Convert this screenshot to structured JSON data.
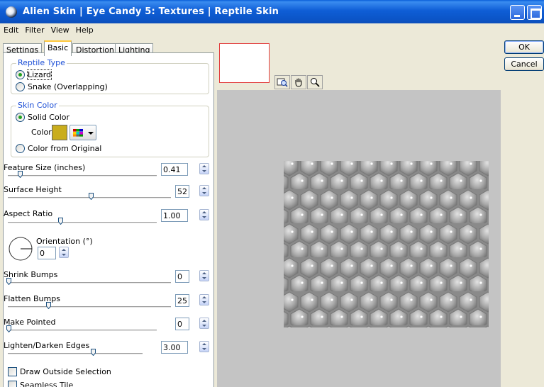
{
  "window": {
    "title": "Alien Skin | Eye Candy 5: Textures | Reptile Skin"
  },
  "menu": [
    "Edit",
    "Filter",
    "View",
    "Help"
  ],
  "tabs": [
    "Settings",
    "Basic",
    "Distortion",
    "Lighting"
  ],
  "active_tab": "Basic",
  "reptile_type": {
    "title": "Reptile Type",
    "options": [
      "Lizard",
      "Snake (Overlapping)"
    ],
    "selected": "Lizard"
  },
  "skin_color": {
    "title": "Skin Color",
    "solid_label": "Solid Color",
    "color_label": "Color",
    "from_original_label": "Color from Original",
    "selected": "Solid Color",
    "swatch_color": "#c9ad1c"
  },
  "controls": {
    "feature_size": {
      "label": "Feature Size (inches)",
      "value": "0.41",
      "level": 0.08
    },
    "surface_height": {
      "label": "Surface Height",
      "value": "52",
      "level": 0.52
    },
    "aspect_ratio": {
      "label": "Aspect Ratio",
      "value": "1.00",
      "level": 0.36
    },
    "orientation": {
      "label": "Orientation (°)",
      "value": "0"
    },
    "shrink_bumps": {
      "label": "Shrink Bumps",
      "value": "0",
      "level": 0.0
    },
    "flatten_bumps": {
      "label": "Flatten Bumps",
      "value": "25",
      "level": 0.25
    },
    "make_pointed": {
      "label": "Make Pointed",
      "value": "0",
      "level": 0.0
    },
    "lighten_darken_edges": {
      "label": "Lighten/Darken Edges",
      "value": "3.00",
      "level": 0.65
    }
  },
  "checkboxes": {
    "draw_outside_selection": "Draw Outside Selection",
    "seamless_tile": "Seamless Tile"
  },
  "buttons": {
    "ok": "OK",
    "cancel": "Cancel"
  },
  "icons": {
    "preview_tools": [
      "zoom-fit-icon",
      "hand-icon",
      "magnifier-icon"
    ]
  },
  "colors": {
    "preview_background": "#c4c4c4",
    "group_title": "#1d4fd6",
    "titlebar": "#0b55c8"
  }
}
